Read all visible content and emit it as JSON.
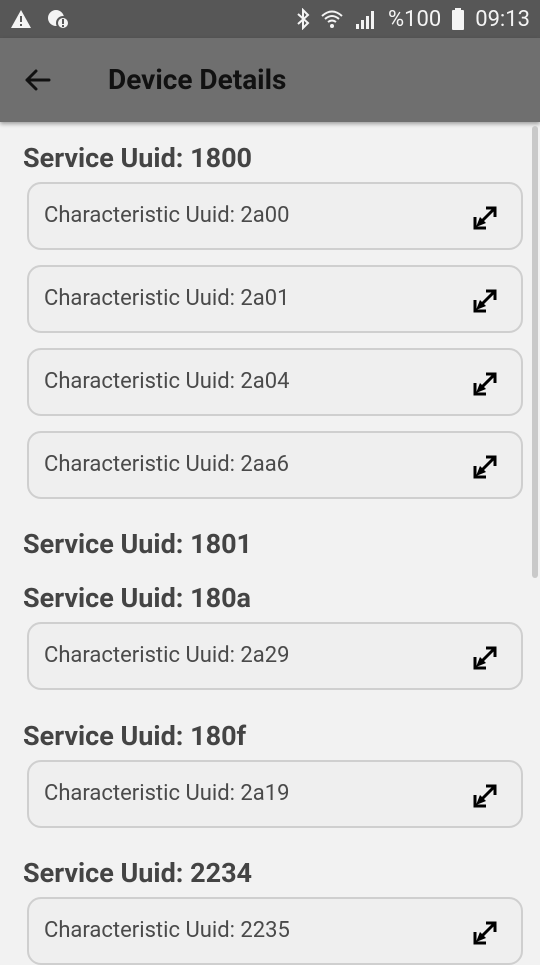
{
  "status_bar": {
    "battery": "%100",
    "time": "09:13",
    "icons_left": [
      "warning-icon",
      "alert-chat-icon"
    ],
    "icons_right": [
      "bluetooth-icon",
      "wifi-icon",
      "signal-icon",
      "battery-icon"
    ]
  },
  "app_bar": {
    "title": "Device Details",
    "back_icon": "arrow-back-icon"
  },
  "services": [
    {
      "header": "Service Uuid: 1800",
      "characteristics": [
        "Characteristic Uuid: 2a00",
        "Characteristic Uuid: 2a01",
        "Characteristic Uuid: 2a04",
        "Characteristic Uuid: 2aa6"
      ]
    },
    {
      "header": "Service Uuid: 1801",
      "characteristics": []
    },
    {
      "header": "Service Uuid: 180a",
      "characteristics": [
        "Characteristic Uuid: 2a29"
      ]
    },
    {
      "header": "Service Uuid: 180f",
      "characteristics": [
        "Characteristic Uuid: 2a19"
      ]
    },
    {
      "header": "Service Uuid: 2234",
      "characteristics": [
        "Characteristic Uuid: 2235"
      ]
    }
  ],
  "colors": {
    "status_bar": "#575757",
    "app_bar": "#6f6f6f",
    "background": "#f2f2f2",
    "card_border": "#cfcfcf"
  }
}
